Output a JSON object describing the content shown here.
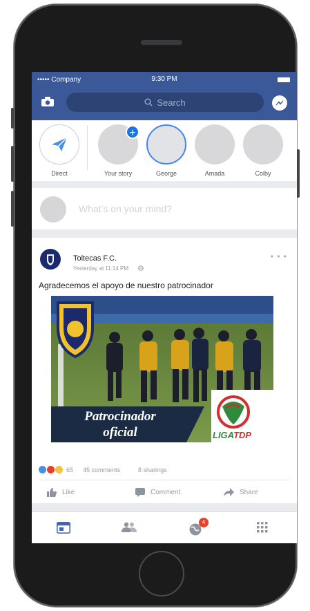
{
  "status_bar": {
    "carrier": "••••• Company",
    "time": "9:30 PM"
  },
  "search": {
    "placeholder": "Search"
  },
  "stories": [
    {
      "label": "Direct"
    },
    {
      "label": "Your story"
    },
    {
      "label": "George"
    },
    {
      "label": "Amada"
    },
    {
      "label": "Colby"
    }
  ],
  "composer": {
    "prompt": "What's on your mind?"
  },
  "post": {
    "author": "Toltecas F.C.",
    "timestamp": "Yesterday at 11:14 PM",
    "text": "Agradecemos el apoyo de nuestro patrocinador",
    "image": {
      "banner_line1": "Patrocinador",
      "banner_line2": "oficial",
      "league_logo": "LIGATDP",
      "league_logo_part1": "LIGA",
      "league_logo_part2": "TDP"
    },
    "reaction_count": "65",
    "comments": "45 comments",
    "shares": "8 sharings",
    "actions": {
      "like": "Like",
      "comment": "Comment",
      "share": "Share"
    }
  },
  "tabbar": {
    "notification_badge": "4"
  },
  "colors": {
    "brand": "#3b5998",
    "accent": "#1a73e8",
    "badge": "#e8412b"
  }
}
